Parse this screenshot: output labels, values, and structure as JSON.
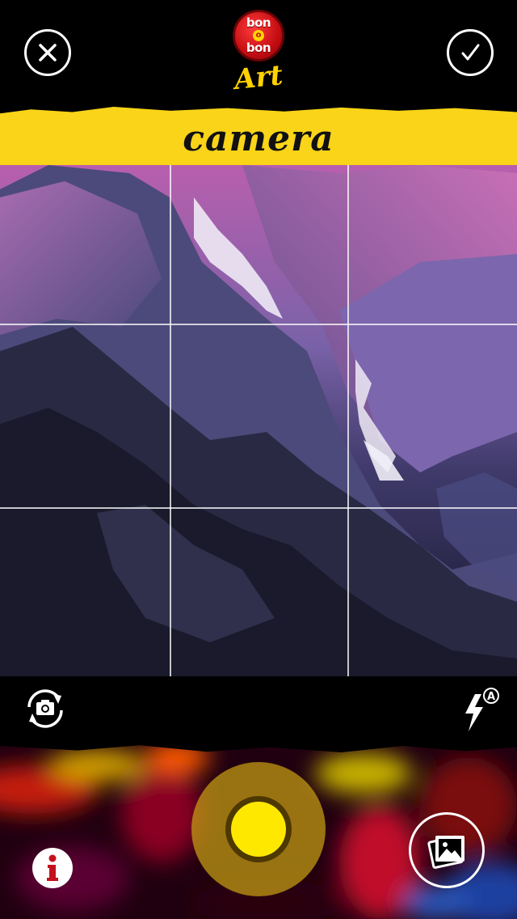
{
  "header": {
    "logo_word_1": "bon",
    "logo_word_2": "o",
    "logo_word_3": "bon",
    "logo_subtitle": "Art",
    "close_icon": "close-icon",
    "confirm_icon": "checkmark-icon"
  },
  "banner": {
    "title": "camera"
  },
  "controls": {
    "flip_icon": "camera-flip-icon",
    "flash_icon": "flash-auto-icon",
    "flash_mode_badge": "A"
  },
  "bottom": {
    "info_icon": "info-icon",
    "gallery_icon": "photo-gallery-icon",
    "shutter_icon": "shutter-button"
  },
  "colors": {
    "accent_yellow": "#f9d418",
    "shutter_yellow": "#ffe800",
    "logo_red": "#c40d12",
    "background": "#000000"
  }
}
